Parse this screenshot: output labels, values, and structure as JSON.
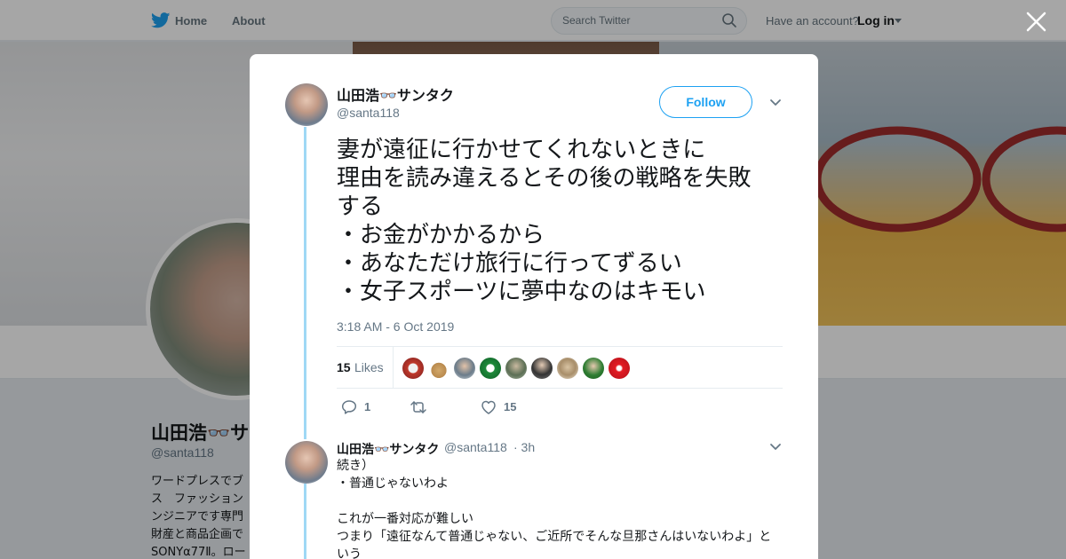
{
  "nav": {
    "home": "Home",
    "about": "About",
    "search_placeholder": "Search Twitter",
    "have_account": "Have an account?",
    "login": "Log in"
  },
  "profile": {
    "name": "山田浩👓サ",
    "handle": "@santa118",
    "bio_lines": [
      "ワードプレスでブ",
      "ス　ファッション",
      "ンジニアです専門",
      "財産と商品企画で",
      "SONYα77Ⅱ。ロー"
    ]
  },
  "tweet": {
    "author_name": "山田浩👓サンタク",
    "author_handle": "@santa118",
    "follow_label": "Follow",
    "text_lines": [
      "妻が遠征に行かせてくれないときに",
      "理由を読み違えるとその後の戦略を失敗",
      "する",
      "・お金がかかるから",
      "・あなただけ旅行に行ってずるい",
      "・女子スポーツに夢中なのはキモい"
    ],
    "timestamp": "3:18 AM - 6 Oct 2019",
    "likes_count": "15",
    "likes_label": "Likes",
    "reply_count": "1",
    "retweet_count": "",
    "like_count": "15"
  },
  "reply": {
    "author_name": "山田浩👓サンタク",
    "author_handle": "@santa118",
    "time": "· 3h",
    "text_lines": [
      "続き）",
      "・普通じゃないわよ",
      "",
      "これが一番対応が難しい",
      "つまり「遠征なんて普通じゃない、ご近所でそんな旦那さんはいないわよ」と",
      "いう"
    ]
  },
  "colors": {
    "twitter_blue": "#1da1f2",
    "thread_line": "#9fd8f5",
    "secondary_text": "#657786"
  }
}
